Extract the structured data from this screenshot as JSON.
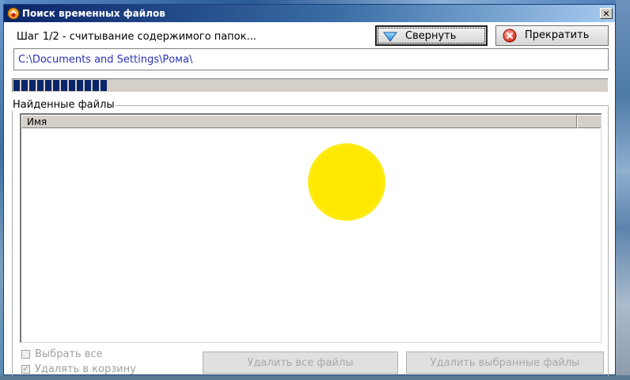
{
  "window": {
    "title": "Поиск временных файлов"
  },
  "status": {
    "step_label": "Шаг 1/2 - считывание содержимого папок...",
    "current_path": "C:\\Documents and Settings\\Рома\\",
    "progress_percent": 16
  },
  "toolbar": {
    "minimize_label": "Свернуть",
    "stop_label": "Прекратить"
  },
  "found_files": {
    "group_label": "Найденные файлы",
    "columns": [
      "Имя"
    ],
    "rows": []
  },
  "options": {
    "select_all_label": "Выбрать все",
    "select_all_checked": false,
    "recycle_label": "Удалять в корзину",
    "recycle_checked": true
  },
  "actions": {
    "delete_all_label": "Удалить все файлы",
    "delete_selected_label": "Удалить выбранные файлы"
  },
  "colors": {
    "title_start": "#0a246a",
    "title_end": "#a6caf0",
    "progress": "#0a246a",
    "path_text": "#2a32b8",
    "overlay_dot": "#ffe800"
  }
}
